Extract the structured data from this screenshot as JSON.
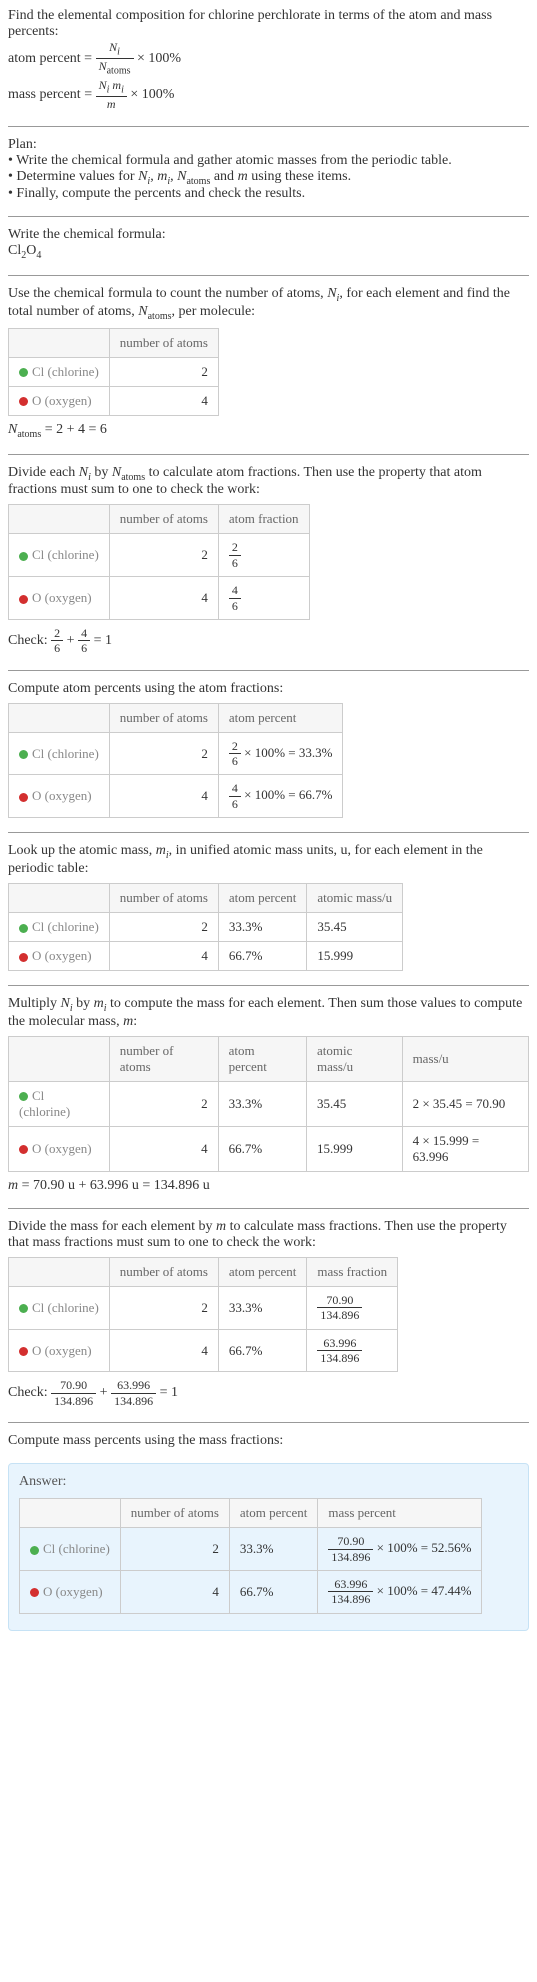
{
  "intro": {
    "line1": "Find the elemental composition for chlorine perchlorate in terms of the atom and mass percents:",
    "atom_percent_lhs": "atom percent = ",
    "atom_percent_num": "N_i",
    "atom_percent_den": "N_atoms",
    "times100": " × 100%",
    "mass_percent_lhs": "mass percent = ",
    "mass_percent_num": "N_i m_i",
    "mass_percent_den": "m"
  },
  "plan": {
    "title": "Plan:",
    "b1": "• Write the chemical formula and gather atomic masses from the periodic table.",
    "b2_a": "• Determine values for ",
    "b2_b": " using these items.",
    "vars": "N_i, m_i, N_atoms and m",
    "b3": "• Finally, compute the percents and check the results."
  },
  "formula_section": {
    "title": "Write the chemical formula:",
    "formula": "Cl₂O₄"
  },
  "count_section": {
    "text_a": "Use the chemical formula to count the number of atoms, ",
    "Ni": "N_i",
    "text_b": ", for each element and find the total number of atoms, ",
    "Na": "N_atoms",
    "text_c": ", per molecule:",
    "headers": {
      "empty": "",
      "num": "number of atoms"
    },
    "rows": {
      "cl": {
        "label": "Cl (chlorine)",
        "n": "2"
      },
      "o": {
        "label": "O (oxygen)",
        "n": "4"
      }
    },
    "sum": "N_atoms = 2 + 4 = 6"
  },
  "atomfrac_section": {
    "text_a": "Divide each ",
    "text_b": " by ",
    "text_c": " to calculate atom fractions. Then use the property that atom fractions must sum to one to check the work:",
    "headers": {
      "num": "number of atoms",
      "frac": "atom fraction"
    },
    "rows": {
      "cl": {
        "n": "2",
        "frac_num": "2",
        "frac_den": "6"
      },
      "o": {
        "n": "4",
        "frac_num": "4",
        "frac_den": "6"
      }
    },
    "check_a": "Check: ",
    "check_eq": " = 1"
  },
  "atompct_section": {
    "title": "Compute atom percents using the atom fractions:",
    "headers": {
      "num": "number of atoms",
      "pct": "atom percent"
    },
    "rows": {
      "cl": {
        "n": "2",
        "frac_num": "2",
        "frac_den": "6",
        "pct": " × 100% = 33.3%"
      },
      "o": {
        "n": "4",
        "frac_num": "4",
        "frac_den": "6",
        "pct": " × 100% = 66.7%"
      }
    }
  },
  "atomicmass_section": {
    "text_a": "Look up the atomic mass, ",
    "mi": "m_i",
    "text_b": ", in unified atomic mass units, u, for each element in the periodic table:",
    "headers": {
      "num": "number of atoms",
      "pct": "atom percent",
      "mass": "atomic mass/u"
    },
    "rows": {
      "cl": {
        "n": "2",
        "pct": "33.3%",
        "mass": "35.45"
      },
      "o": {
        "n": "4",
        "pct": "66.7%",
        "mass": "15.999"
      }
    }
  },
  "massu_section": {
    "text_a": "Multiply ",
    "text_b": " by ",
    "text_c": " to compute the mass for each element. Then sum those values to compute the molecular mass, ",
    "m": "m",
    "text_d": ":",
    "headers": {
      "num": "number of atoms",
      "pct": "atom percent",
      "mass": "atomic mass/u",
      "mu": "mass/u"
    },
    "rows": {
      "cl": {
        "n": "2",
        "pct": "33.3%",
        "mass": "35.45",
        "mu": "2 × 35.45 = 70.90"
      },
      "o": {
        "n": "4",
        "pct": "66.7%",
        "mass": "15.999",
        "mu": "4 × 15.999 = 63.996"
      }
    },
    "sum": "m = 70.90 u + 63.996 u = 134.896 u"
  },
  "massfrac_section": {
    "text_a": "Divide the mass for each element by ",
    "text_b": " to calculate mass fractions. Then use the property that mass fractions must sum to one to check the work:",
    "headers": {
      "num": "number of atoms",
      "pct": "atom percent",
      "frac": "mass fraction"
    },
    "rows": {
      "cl": {
        "n": "2",
        "pct": "33.3%",
        "num": "70.90",
        "den": "134.896"
      },
      "o": {
        "n": "4",
        "pct": "66.7%",
        "num": "63.996",
        "den": "134.896"
      }
    },
    "check_a": "Check: ",
    "check_eq": " = 1"
  },
  "masspct_section": {
    "title": "Compute mass percents using the mass fractions:"
  },
  "answer": {
    "title": "Answer:",
    "headers": {
      "num": "number of atoms",
      "pct": "atom percent",
      "mpct": "mass percent"
    },
    "rows": {
      "cl": {
        "n": "2",
        "pct": "33.3%",
        "num": "70.90",
        "den": "134.896",
        "res": " × 100% = 52.56%"
      },
      "o": {
        "n": "4",
        "pct": "66.7%",
        "num": "63.996",
        "den": "134.896",
        "res": " × 100% = 47.44%"
      }
    }
  }
}
